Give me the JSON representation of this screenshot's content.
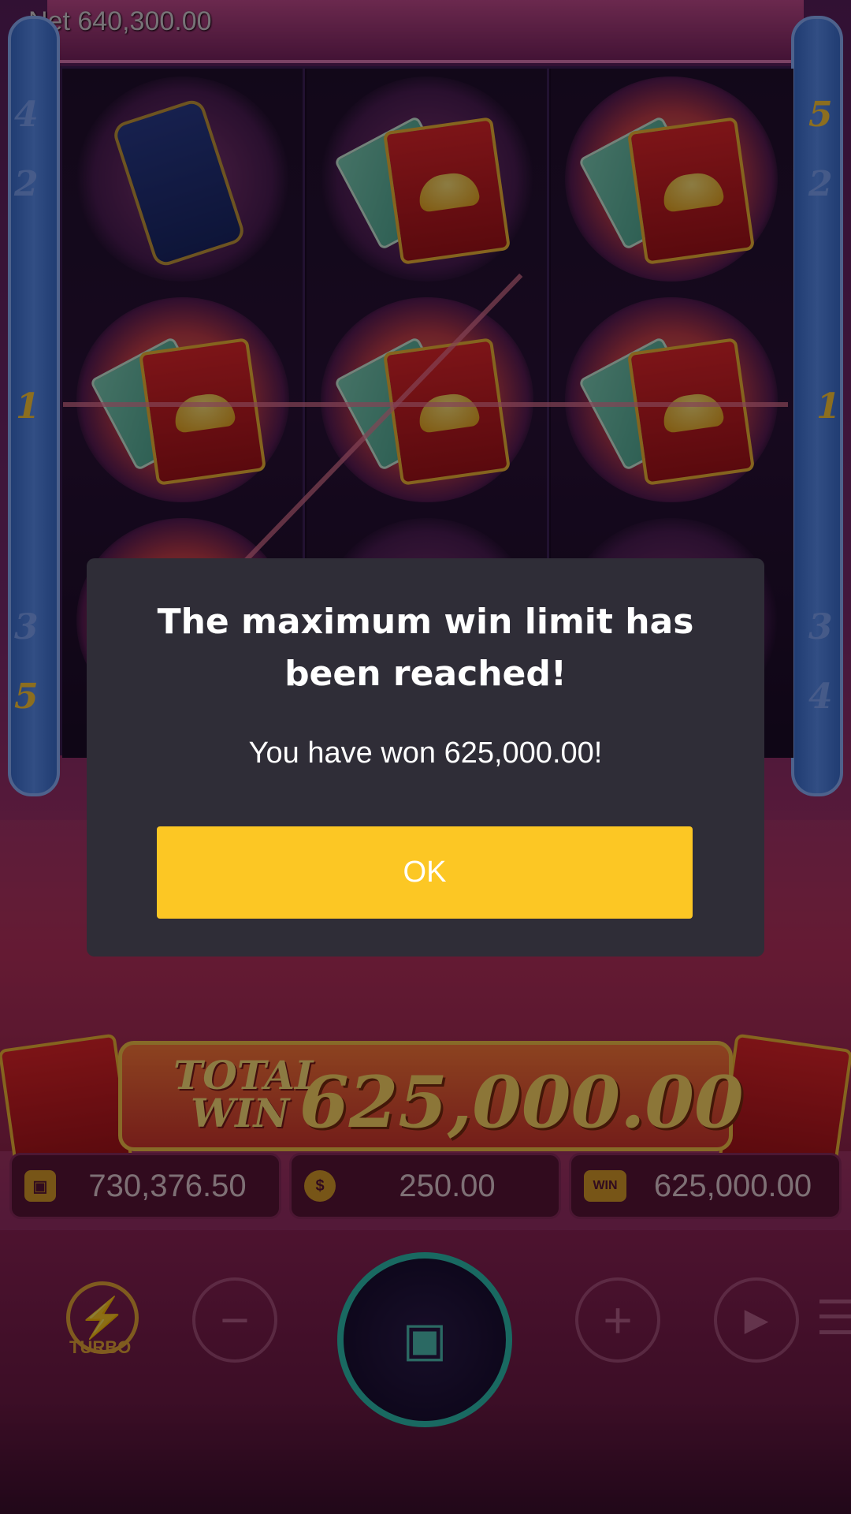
{
  "header": {
    "net_text": "Net 640,300.00"
  },
  "paylines": {
    "left": [
      "4",
      "2",
      "1",
      "3",
      "5"
    ],
    "right": [
      "5",
      "2",
      "1",
      "3",
      "4"
    ]
  },
  "reels": [
    [
      "firecracker",
      "red-envelope",
      "red-envelope"
    ],
    [
      "red-envelope",
      "red-envelope",
      "hidden"
    ],
    [
      "red-envelope",
      "red-envelope",
      "hidden"
    ]
  ],
  "total_win": {
    "label_line1": "TOTAL",
    "label_line2": "WIN",
    "value": "625,000.00"
  },
  "stats": {
    "balance": {
      "icon": "wallet-icon",
      "value": "730,376.50"
    },
    "bet": {
      "icon": "coins-icon",
      "value": "250.00"
    },
    "win": {
      "icon": "win-icon",
      "icon_text": "WIN",
      "value": "625,000.00"
    }
  },
  "controls": {
    "turbo_label": "TURBO",
    "minus": "−",
    "plus": "+",
    "play": "▶"
  },
  "dialog": {
    "title": "The maximum win limit has been reached!",
    "message": "You have won 625,000.00!",
    "ok_label": "OK"
  },
  "colors": {
    "dialog_bg": "#2f2d37",
    "ok_button": "#fcc724",
    "gold": "#ffd866",
    "teal": "#2fbfb1"
  }
}
